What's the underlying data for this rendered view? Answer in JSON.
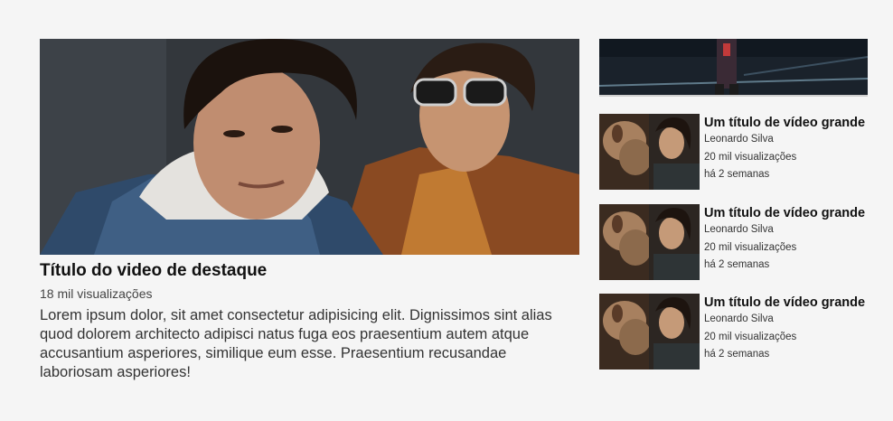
{
  "featured": {
    "title": "Título do video de destaque",
    "views": "18 mil visualizações",
    "description": "Lorem ipsum dolor, sit amet consectetur adipisicing elit. Dignissimos sint alias quod dolorem architecto adipisci natus fuga eos praesentium autem atque accusantium asperiores, similique eum esse. Praesentium recusandae laboriosam asperiores!"
  },
  "sidebar": {
    "videos": [
      {
        "title": "Um título de vídeo grande",
        "channel": "Leonardo Silva",
        "views": "20 mil visualizações",
        "date": "há 2 semanas"
      },
      {
        "title": "Um título de vídeo grande",
        "channel": "Leonardo Silva",
        "views": "20 mil visualizações",
        "date": "há 2 semanas"
      },
      {
        "title": "Um título de vídeo grande",
        "channel": "Leonardo Silva",
        "views": "20 mil visualizações",
        "date": "há 2 semanas"
      }
    ]
  },
  "colors": {
    "background": "#f5f5f5",
    "text": "#111111",
    "meta_text": "#333333"
  }
}
